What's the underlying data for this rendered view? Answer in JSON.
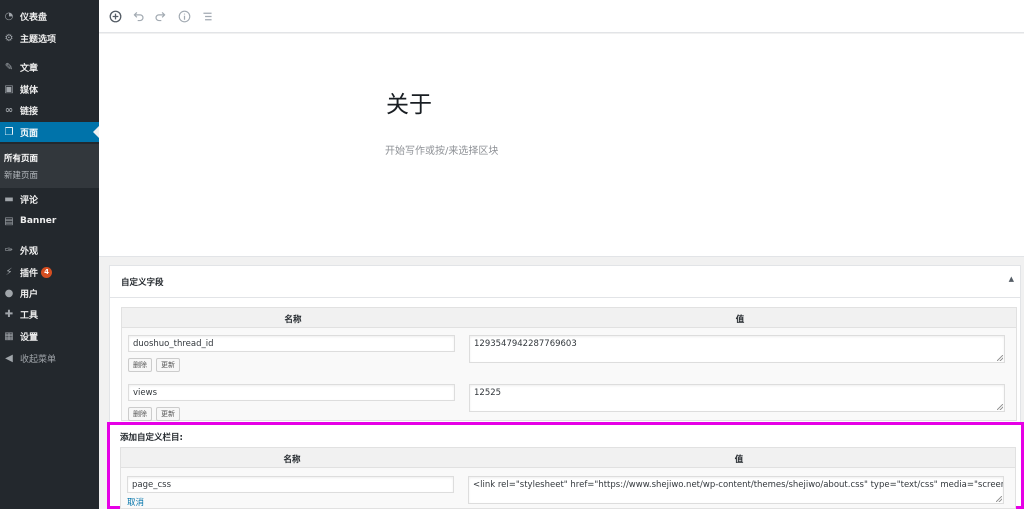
{
  "sidebar": {
    "items": [
      {
        "icon": "dashboard-icon",
        "glyph": "◔",
        "label": "仪表盘"
      },
      {
        "icon": "gear-icon",
        "glyph": "⚙",
        "label": "主题选项"
      },
      {
        "icon": "pin-icon",
        "glyph": "✎",
        "label": "文章"
      },
      {
        "icon": "media-icon",
        "glyph": "▣",
        "label": "媒体"
      },
      {
        "icon": "link-icon",
        "glyph": "∞",
        "label": "链接"
      },
      {
        "icon": "pages-icon",
        "glyph": "❐",
        "label": "页面"
      },
      {
        "icon": "comment-icon",
        "glyph": "▬",
        "label": "评论"
      },
      {
        "icon": "banner-icon",
        "glyph": "▤",
        "label": "Banner"
      },
      {
        "icon": "appearance-icon",
        "glyph": "✑",
        "label": "外观"
      },
      {
        "icon": "plugin-icon",
        "glyph": "⚡",
        "label": "插件",
        "badge": "4"
      },
      {
        "icon": "user-icon",
        "glyph": "●",
        "label": "用户"
      },
      {
        "icon": "tools-icon",
        "glyph": "✚",
        "label": "工具"
      },
      {
        "icon": "settings-icon",
        "glyph": "▦",
        "label": "设置"
      },
      {
        "icon": "collapse-icon",
        "glyph": "◀",
        "label": "收起菜单"
      }
    ],
    "submenu": [
      "所有页面",
      "新建页面"
    ],
    "active_color": "#0073aa",
    "bg_color": "#23282d"
  },
  "toolbar": {
    "buttons": [
      "add-block-icon",
      "undo-icon",
      "redo-icon",
      "info-icon",
      "outline-icon"
    ]
  },
  "editor": {
    "title": "关于",
    "placeholder": "开始写作或按/来选择区块"
  },
  "custom_fields": {
    "title": "自定义字段",
    "col_name": "名称",
    "col_value": "值",
    "rows": [
      {
        "name": "duoshuo_thread_id",
        "value": "1293547942287769603",
        "delete": "删除",
        "update": "更新"
      },
      {
        "name": "views",
        "value": "12525",
        "delete": "删除",
        "update": "更新"
      }
    ],
    "add_new": {
      "title": "添加自定义栏目:",
      "col_name": "名称",
      "col_value": "值",
      "name": "page_css",
      "value": "<link rel=\"stylesheet\" href=\"https://www.shejiwo.net/wp-content/themes/shejiwo/about.css\" type=\"text/css\" media=\"screen\" />",
      "cancel": "取消",
      "highlight_color": "#e600e6"
    }
  }
}
